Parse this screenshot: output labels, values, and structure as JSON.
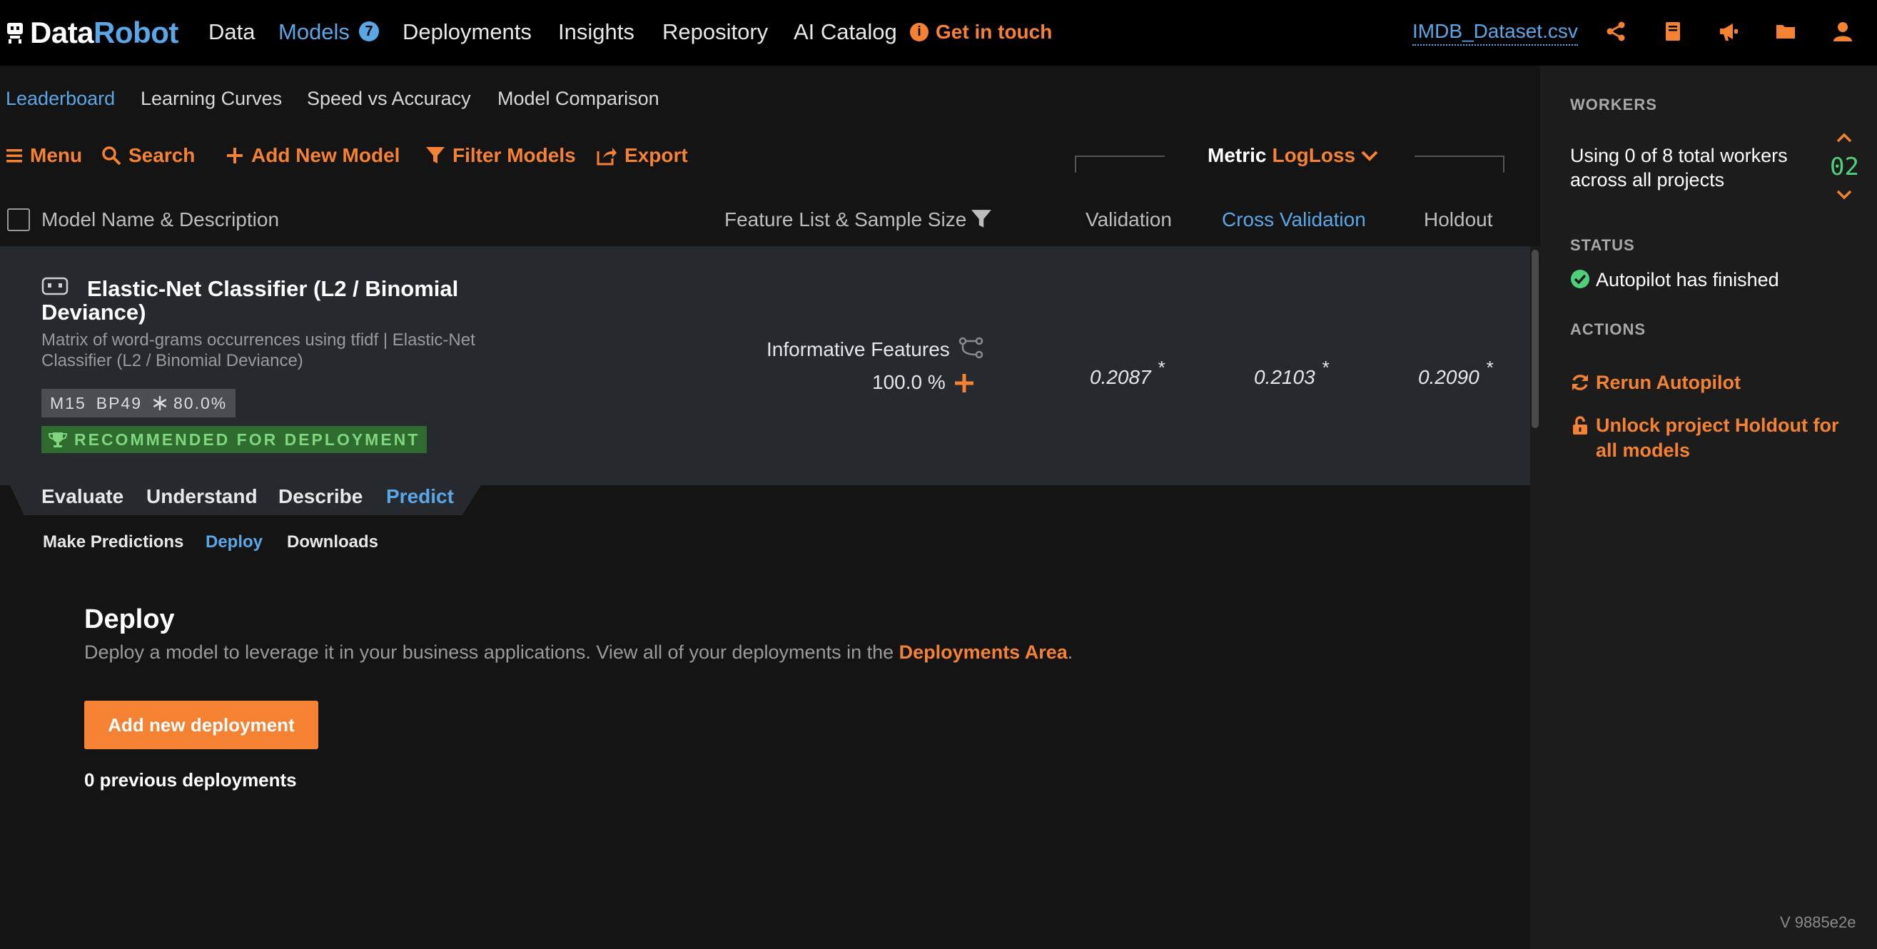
{
  "brand": {
    "part1": "Data",
    "part2": "Robot"
  },
  "topnav": {
    "items": [
      {
        "label": "Data"
      },
      {
        "label": "Models"
      },
      {
        "label": "Deployments"
      },
      {
        "label": "Insights"
      },
      {
        "label": "Repository"
      },
      {
        "label": "AI Catalog"
      }
    ],
    "models_badge": "7",
    "get_in_touch": "Get in touch",
    "dataset": "IMDB_Dataset.csv"
  },
  "subnav": {
    "items": [
      {
        "label": "Leaderboard"
      },
      {
        "label": "Learning Curves"
      },
      {
        "label": "Speed vs Accuracy"
      },
      {
        "label": "Model Comparison"
      }
    ]
  },
  "toolbar": {
    "menu": "Menu",
    "search": "Search",
    "add_model": "Add New Model",
    "filter": "Filter Models",
    "export": "Export",
    "metric_label": "Metric",
    "metric_value": "LogLoss"
  },
  "table": {
    "headers": {
      "model": "Model Name & Description",
      "feature": "Feature List & Sample Size",
      "validation": "Validation",
      "cross_validation": "Cross Validation",
      "holdout": "Holdout"
    }
  },
  "model": {
    "title": "Elastic-Net Classifier (L2 / Binomial Deviance)",
    "description": "Matrix of word-grams occurrences using tfidf | Elastic-Net Classifier (L2 / Binomial Deviance)",
    "tag_model": "M15",
    "tag_bp": "BP49",
    "tag_sample": "80.0%",
    "recommended": "RECOMMENDED FOR DEPLOYMENT",
    "feature_list": "Informative Features",
    "sample_size": "100.0 %",
    "validation": "0.2087",
    "cross_validation": "0.2103",
    "holdout": "0.2090",
    "star": "*"
  },
  "tabs": {
    "items": [
      {
        "label": "Evaluate"
      },
      {
        "label": "Understand"
      },
      {
        "label": "Describe"
      },
      {
        "label": "Predict"
      }
    ],
    "subtabs": [
      {
        "label": "Make Predictions"
      },
      {
        "label": "Deploy"
      },
      {
        "label": "Downloads"
      }
    ]
  },
  "deploy": {
    "title": "Deploy",
    "text": "Deploy a model to leverage it in your business applications. View all of your deployments in the",
    "link": "Deployments Area",
    "text_end": ".",
    "button": "Add new deployment",
    "previous": "0 previous deployments"
  },
  "sidebar": {
    "workers_heading": "WORKERS",
    "workers_text_1": "Using 0 of 8 total workers",
    "workers_text_2": "across all projects",
    "workers_count": "02",
    "status_heading": "STATUS",
    "status_text": "Autopilot has finished",
    "actions_heading": "ACTIONS",
    "rerun": "Rerun Autopilot",
    "unlock_1": "Unlock project Holdout for",
    "unlock_2": "all models"
  },
  "version": "V 9885e2e",
  "colors": {
    "accent": "#f58233",
    "link_blue": "#5aa7e8",
    "success_green": "#4fcf7a",
    "background": "#141414"
  }
}
